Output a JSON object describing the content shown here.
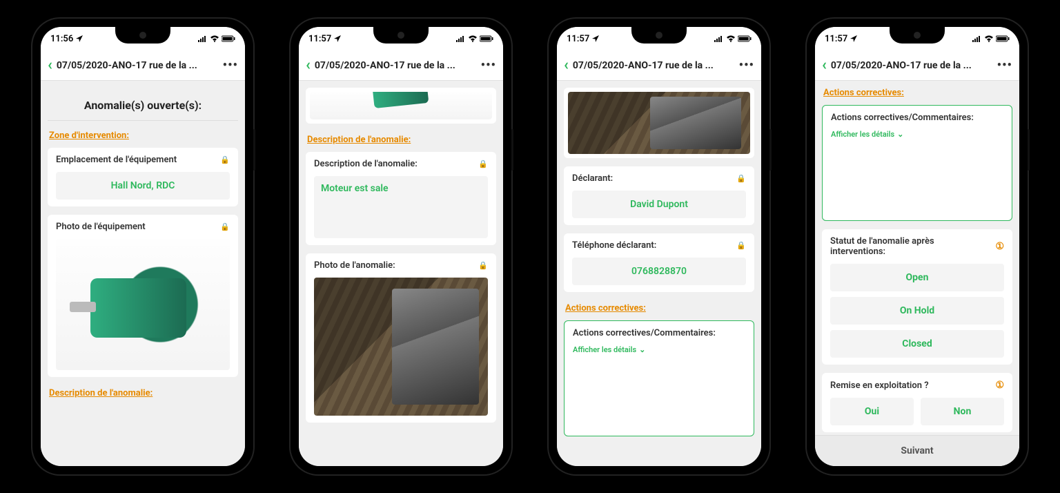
{
  "status": {
    "time": "11:56",
    "time2": "11:57"
  },
  "appbar": {
    "title": "07/05/2020-ANO-17 rue de la ..."
  },
  "screen1": {
    "page_title": "Anomalie(s) ouverte(s):",
    "section_zone": "Zone d'intervention:",
    "location_label": "Emplacement de l'équipement",
    "location_value": "Hall Nord, RDC",
    "photo_equip_label": "Photo de l'équipement",
    "section_desc": "Description de l'anomalie:"
  },
  "screen2": {
    "section_desc": "Description de l'anomalie:",
    "desc_label": "Description de l'anomalie:",
    "desc_value": "Moteur est sale",
    "photo_anom_label": "Photo de l'anomalie:"
  },
  "screen3": {
    "declarant_label": "Déclarant:",
    "declarant_value": "David Dupont",
    "phone_label": "Téléphone déclarant:",
    "phone_value": "0768828870",
    "section_actions": "Actions correctives:",
    "actions_label": "Actions correctives/Commentaires:",
    "details_toggle": "Afficher les détails"
  },
  "screen4": {
    "section_actions": "Actions correctives:",
    "actions_label": "Actions correctives/Commentaires:",
    "details_toggle": "Afficher les détails",
    "status_label": "Statut de l'anomalie après interventions:",
    "status_options": [
      "Open",
      "On Hold",
      "Closed"
    ],
    "remise_label": "Remise en exploitation ?",
    "remise_options": [
      "Oui",
      "Non"
    ],
    "footer_next": "Suivant"
  }
}
